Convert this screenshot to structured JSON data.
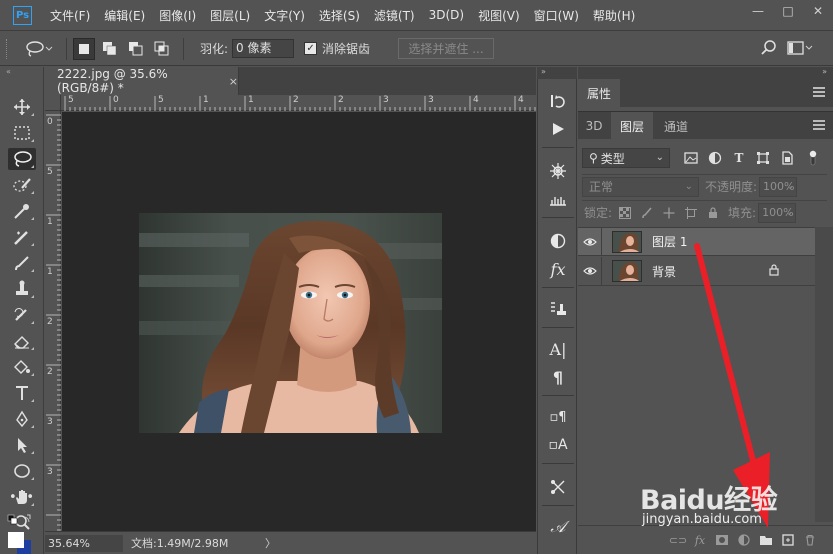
{
  "app": {
    "logo": "Ps"
  },
  "menu": [
    "文件(F)",
    "编辑(E)",
    "图像(I)",
    "图层(L)",
    "文字(Y)",
    "选择(S)",
    "滤镜(T)",
    "3D(D)",
    "视图(V)",
    "窗口(W)",
    "帮助(H)"
  ],
  "window_controls": {
    "minimize": "—",
    "maximize": "□",
    "close": "✕"
  },
  "options_bar": {
    "feather_label": "羽化:",
    "feather_value": "0 像素",
    "antialias_label": "消除锯齿",
    "antialias_checked": true,
    "select_mask_label": "选择并遮住 ..."
  },
  "document": {
    "tab_title": "2222.jpg @ 35.6%(RGB/8#) *",
    "tab_close": "×",
    "ruler_top_labels": [
      "5",
      "0",
      "5",
      "1",
      "1",
      "2",
      "2",
      "3",
      "3",
      "4",
      "4"
    ],
    "ruler_left_labels": [
      "0",
      "5",
      "1",
      "1",
      "2",
      "2",
      "3",
      "3"
    ],
    "zoom": "35.64%",
    "doc_info": "文档:1.49M/2.98M",
    "status_arrow": "〉"
  },
  "properties_panel": {
    "tab_label": "属性"
  },
  "layers_panel": {
    "tabs": [
      "3D",
      "图层",
      "通道"
    ],
    "active_tab": "图层",
    "filter_kind": "类型",
    "blend_mode": "正常",
    "opacity_label": "不透明度:",
    "opacity_value": "100%",
    "lock_label": "锁定:",
    "fill_label": "填充:",
    "fill_value": "100%",
    "layers": [
      {
        "name": "图层 1",
        "visible": true,
        "selected": true,
        "locked": false
      },
      {
        "name": "背景",
        "visible": true,
        "selected": false,
        "locked": true
      }
    ]
  },
  "icon_strip": [
    "history-icon",
    "play-icon",
    "brush-settings-icon",
    "clone-source-icon",
    "adjustments-icon",
    "styles-icon",
    "tool-presets-icon",
    "character-icon",
    "paragraph-icon",
    "paragraph-styles-icon",
    "character-styles-icon",
    "path-icon",
    "glyphs-icon"
  ],
  "watermark": {
    "brand": "Baidu经验",
    "url": "jingyan.baidu.com"
  },
  "colors": {
    "ui_bg": "#535353",
    "dark_bg": "#424242",
    "canvas_bg": "#282828",
    "arrow": "#e8202a",
    "ps_blue": "#2fa3f7"
  }
}
